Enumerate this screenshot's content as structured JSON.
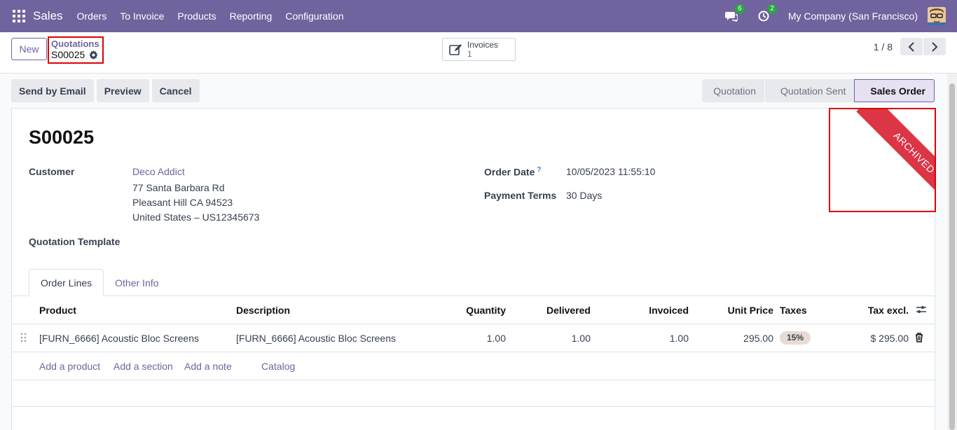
{
  "navbar": {
    "brand": "Sales",
    "menu": [
      "Orders",
      "To Invoice",
      "Products",
      "Reporting",
      "Configuration"
    ],
    "messages_count": "6",
    "activities_count": "2",
    "company": "My Company (San Francisco)"
  },
  "control": {
    "new_label": "New",
    "breadcrumb_parent": "Quotations",
    "breadcrumb_current": "S00025",
    "smart_button_label": "Invoices",
    "smart_button_count": "1",
    "pager_value": "1 / 8"
  },
  "actions": [
    "Send by Email",
    "Preview",
    "Cancel"
  ],
  "stages": [
    "Quotation",
    "Quotation Sent",
    "Sales Order"
  ],
  "form": {
    "title": "S00025",
    "customer_label": "Customer",
    "customer_name": "Deco Addict",
    "address_line1": "77 Santa Barbara Rd",
    "address_line2": "Pleasant Hill CA 94523",
    "address_line3": "United States – US12345673",
    "quotation_template_label": "Quotation Template",
    "order_date_label": "Order Date",
    "order_date_help": "?",
    "order_date_value": "10/05/2023 11:55:10",
    "payment_terms_label": "Payment Terms",
    "payment_terms_value": "30 Days",
    "ribbon": "ARCHIVED"
  },
  "tabs": [
    "Order Lines",
    "Other Info"
  ],
  "table": {
    "headers": {
      "product": "Product",
      "description": "Description",
      "quantity": "Quantity",
      "delivered": "Delivered",
      "invoiced": "Invoiced",
      "unit_price": "Unit Price",
      "taxes": "Taxes",
      "tax_excl": "Tax excl."
    },
    "rows": [
      {
        "product": "[FURN_6666] Acoustic Bloc Screens",
        "description": "[FURN_6666] Acoustic Bloc Screens",
        "quantity": "1.00",
        "delivered": "1.00",
        "invoiced": "1.00",
        "unit_price": "295.00",
        "taxes": "15%",
        "tax_excl": "$ 295.00"
      }
    ],
    "add_links": [
      "Add a product",
      "Add a section",
      "Add a note",
      "Catalog"
    ]
  }
}
